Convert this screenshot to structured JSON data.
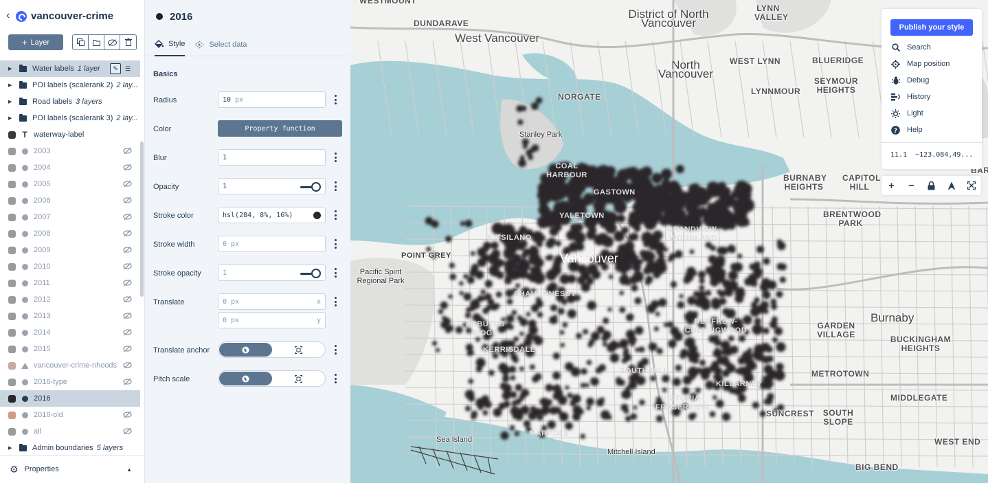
{
  "header": {
    "back_icon": "chevron-left-icon",
    "style_name": "vancouver-crime"
  },
  "toolbar": {
    "add_layer_label": "Layer",
    "add_icon": "plus-icon"
  },
  "layers": [
    {
      "name": "Water labels",
      "count": "1 layer",
      "kind": "folder",
      "selected": true,
      "hidden": false
    },
    {
      "name": "POI labels (scalerank 2)",
      "count": "2 lay...",
      "kind": "folder",
      "hidden": false
    },
    {
      "name": "Road labels",
      "count": "3 layers",
      "kind": "folder",
      "hidden": false
    },
    {
      "name": "POI labels (scalerank 3)",
      "count": "2 lay...",
      "kind": "folder",
      "hidden": false
    },
    {
      "name": "waterway-label",
      "kind": "symbol",
      "swatch": "#3b3b3b",
      "hidden": false
    },
    {
      "name": "2003",
      "kind": "circle",
      "swatch": "#9b9b9b",
      "hidden": true
    },
    {
      "name": "2004",
      "kind": "circle",
      "swatch": "#9b9b9b",
      "hidden": true
    },
    {
      "name": "2005",
      "kind": "circle",
      "swatch": "#9b9b9b",
      "hidden": true
    },
    {
      "name": "2006",
      "kind": "circle",
      "swatch": "#9b9b9b",
      "hidden": true
    },
    {
      "name": "2007",
      "kind": "circle",
      "swatch": "#9b9b9b",
      "hidden": true
    },
    {
      "name": "2008",
      "kind": "circle",
      "swatch": "#9b9b9b",
      "hidden": true
    },
    {
      "name": "2009",
      "kind": "circle",
      "swatch": "#9b9b9b",
      "hidden": true
    },
    {
      "name": "2010",
      "kind": "circle",
      "swatch": "#9b9b9b",
      "hidden": true
    },
    {
      "name": "2011",
      "kind": "circle",
      "swatch": "#9b9b9b",
      "hidden": true
    },
    {
      "name": "2012",
      "kind": "circle",
      "swatch": "#9b9b9b",
      "hidden": true
    },
    {
      "name": "2013",
      "kind": "circle",
      "swatch": "#9b9b9b",
      "hidden": true
    },
    {
      "name": "2014",
      "kind": "circle",
      "swatch": "#9b9b9b",
      "hidden": true
    },
    {
      "name": "2015",
      "kind": "circle",
      "swatch": "#9b9b9b",
      "hidden": true
    },
    {
      "name": "vancouver-crime-nhoods",
      "kind": "fill",
      "swatch": "#c9aaa5",
      "hidden": true
    },
    {
      "name": "2016-type",
      "kind": "circle",
      "swatch": "#9b9b9b",
      "hidden": true
    },
    {
      "name": "2016",
      "kind": "circle",
      "swatch": "#2b262c",
      "hidden": false,
      "active": true
    },
    {
      "name": "2016-old",
      "kind": "circle",
      "swatch": "#d49a86",
      "hidden": true
    },
    {
      "name": "all",
      "kind": "circle",
      "swatch": "#9b9b9b",
      "hidden": true
    },
    {
      "name": "Admin boundaries",
      "count": "5 layers",
      "kind": "folder",
      "hidden": false
    }
  ],
  "footer": {
    "label": "Properties"
  },
  "props": {
    "title": "2016",
    "tabs": {
      "style": "Style",
      "select_data": "Select data"
    },
    "section": "Basics",
    "radius": {
      "label": "Radius",
      "value": "10",
      "unit": "px"
    },
    "color": {
      "label": "Color",
      "button": "Property function"
    },
    "blur": {
      "label": "Blur",
      "value": "1"
    },
    "opacity": {
      "label": "Opacity",
      "value": "1"
    },
    "stroke_color": {
      "label": "Stroke color",
      "value": "hsl(284, 8%, 16%)",
      "swatch": "#2b262c"
    },
    "stroke_width": {
      "label": "Stroke width",
      "value": "0",
      "unit": "px"
    },
    "stroke_opacity": {
      "label": "Stroke opacity",
      "value": "1"
    },
    "translate": {
      "label": "Translate",
      "x": "0",
      "y": "0",
      "unit": "px",
      "x_axis": "x",
      "y_axis": "y"
    },
    "translate_anchor": {
      "label": "Translate anchor",
      "selected": "map"
    },
    "pitch_scale": {
      "label": "Pitch scale",
      "selected": "map"
    }
  },
  "map_menu": {
    "publish": "Publish your style",
    "items": [
      {
        "label": "Search",
        "icon": "search-icon"
      },
      {
        "label": "Map position",
        "icon": "crosshair-icon"
      },
      {
        "label": "Debug",
        "icon": "bug-icon"
      },
      {
        "label": "History",
        "icon": "history-icon"
      },
      {
        "label": "Light",
        "icon": "sun-icon"
      },
      {
        "label": "Help",
        "icon": "help-icon"
      }
    ],
    "zoom": "11.1",
    "coords": "−123.084,49..."
  },
  "map_labels": {
    "westmount": "WESTMOUNT",
    "dundarave": "DUNDARAVE",
    "west_vancouver": "West Vancouver",
    "district_north_vancouver": "District of North Vancouver",
    "lynn_valley": "LYNN VALLEY",
    "north_vancouver": "North Vancouver",
    "west_lynn": "WEST LYNN",
    "blueridge": "BLUERIDGE",
    "seymour_heights": "SEYMOUR HEIGHTS",
    "lynnmour": "LYNNMOUR",
    "norgate": "NORGATE",
    "stanley_park": "Stanley Park",
    "coal_harbour": "COAL HARBOUR",
    "gastown": "GASTOWN",
    "yaletown": "YALETOWN",
    "burnaby_heights": "BURNABY HEIGHTS",
    "capitol_hill": "CAPITOL HILL",
    "barnet": "BARNE",
    "brentwood_park": "BRENTWOOD PARK",
    "grandview_woodland": "GRANDVIEW-WOODLAND",
    "kitsilano": "KITSILANO",
    "point_grey": "POINT GREY",
    "vancouver": "Vancouver",
    "pacific_spirit": "Pacific Spirit Regional Park",
    "shaughnessy": "SHAUGHNESSY",
    "renfrew": "RENFREW-COLLINGWOOD",
    "burnaby": "Burnaby",
    "garden_village": "GARDEN VILLAGE",
    "buckingham_heights": "BUCKINGHAM HEIGHTS",
    "arbutus_ridge": "ARBUTUS RIDGE",
    "kerrisdale": "KERRISDALE",
    "south_hill": "SOUTH HILL",
    "killarney": "KILLARNEY",
    "metrotown": "METROTOWN",
    "middlegate": "MIDDLEGATE",
    "victoria_fraserview": "VICTORIA-FRASERVIEW",
    "suncrest": "SUNCREST",
    "south_slope": "SOUTH SLOPE",
    "sea_island": "Sea Island",
    "marpole": "MARPOLE",
    "mitchell_island": "Mitchell Island",
    "west_end": "WEST END",
    "big_bend": "BIG BEND"
  }
}
